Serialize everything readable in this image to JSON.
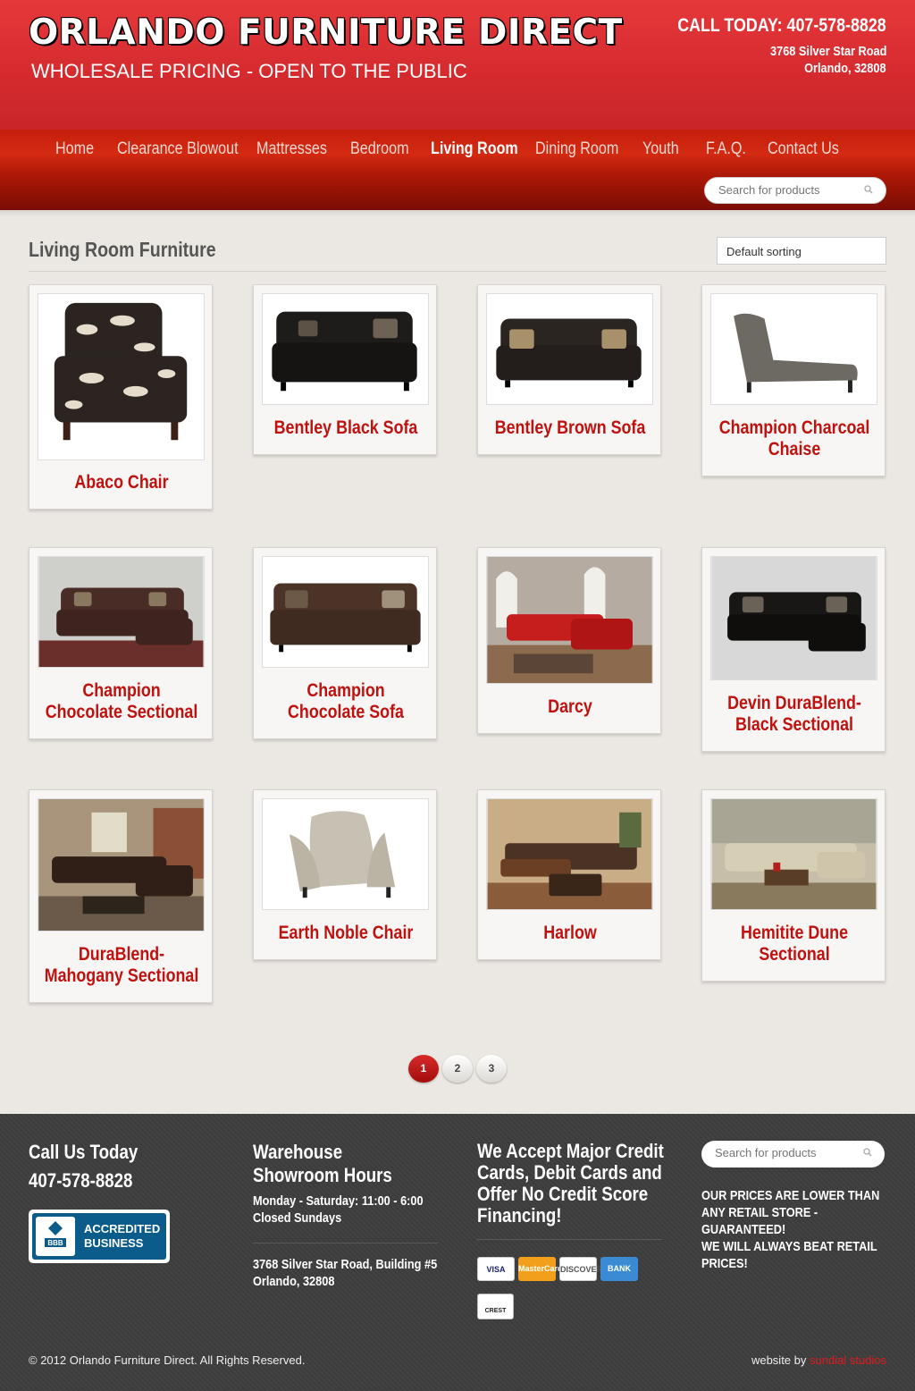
{
  "header": {
    "title": "ORLANDO FURNITURE DIRECT",
    "tagline": "WHOLESALE PRICING - OPEN TO THE PUBLIC",
    "phone_line": "CALL TODAY: 407-578-8828",
    "address_line1": "3768 Silver Star Road",
    "address_line2": "Orlando, 32808"
  },
  "nav": {
    "items": [
      "Home",
      "Clearance Blowout",
      "Mattresses",
      "Bedroom",
      "Living Room",
      "Dining Room",
      "Youth",
      "F.A.Q.",
      "Contact Us"
    ],
    "active": "Living Room",
    "search_placeholder": "Search for products"
  },
  "main": {
    "title": "Living Room Furniture",
    "sort_value": "Default sorting",
    "products": [
      {
        "name": "Abaco Chair"
      },
      {
        "name": "Bentley Black Sofa"
      },
      {
        "name": "Bentley Brown Sofa"
      },
      {
        "name": "Champion Charcoal Chaise"
      },
      {
        "name": "Champion Chocolate Sectional"
      },
      {
        "name": "Champion Chocolate Sofa"
      },
      {
        "name": "Darcy"
      },
      {
        "name": "Devin DuraBlend-Black Sectional"
      },
      {
        "name": "DuraBlend-Mahogany Sectional"
      },
      {
        "name": "Earth Noble Chair"
      },
      {
        "name": "Harlow"
      },
      {
        "name": "Hemitite Dune Sectional"
      }
    ],
    "pages": [
      "1",
      "2",
      "3"
    ],
    "current_page": "1"
  },
  "footer": {
    "col1_heading": "Call Us Today",
    "col1_phone": "407-578-8828",
    "bbb_text": "ACCREDITED BUSINESS",
    "bbb_logo_text": "BBB",
    "col2_heading": "Warehouse Showroom Hours",
    "col2_hours": "Monday - Saturday: 11:00 - 6:00",
    "col2_closed": "Closed Sundays",
    "col2_address1": "3768 Silver Star Road, Building #5",
    "col2_address2": "Orlando, 32808",
    "col3_heading": "We Accept Major Credit Cards, Debit Cards and Offer No Credit Score Financing!",
    "cards": [
      "VISA",
      "MasterCard",
      "DISCOVER",
      "BANK"
    ],
    "crest_label": "CREST",
    "search_placeholder": "Search for products",
    "col4_text1": "OUR PRICES ARE LOWER THAN ANY RETAIL STORE - GUARANTEED!",
    "col4_text2": "WE WILL ALWAYS BEAT RETAIL PRICES!",
    "copyright": "© 2012 Orlando Furniture Direct. All Rights Reserved.",
    "credit_prefix": "website by",
    "credit_name": "sundial studios"
  },
  "colors": {
    "header_red": "#d42a2e",
    "product_title": "#c0110e",
    "footer_bg": "#3c3c3c"
  }
}
